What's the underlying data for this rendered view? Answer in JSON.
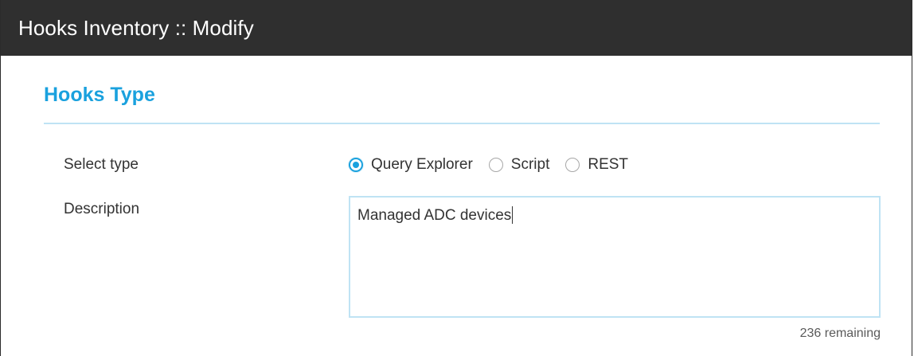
{
  "window": {
    "title": "Hooks Inventory :: Modify"
  },
  "section": {
    "title": "Hooks Type"
  },
  "form": {
    "select_type": {
      "label": "Select type",
      "options": [
        {
          "label": "Query Explorer",
          "selected": true
        },
        {
          "label": "Script",
          "selected": false
        },
        {
          "label": "REST",
          "selected": false
        }
      ]
    },
    "description": {
      "label": "Description",
      "value": "Managed ADC devices",
      "remaining": "236 remaining"
    }
  },
  "colors": {
    "titlebar_bg": "#2f2f2f",
    "accent": "#1aa1de",
    "divider": "#bfe3f4"
  }
}
